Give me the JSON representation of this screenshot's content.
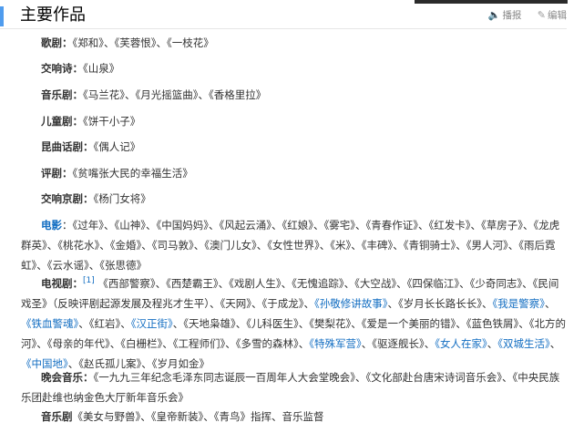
{
  "section": {
    "title": "主要作品",
    "actions": [
      {
        "icon": "speaker-icon",
        "glyph": "🔈",
        "label": "播报"
      },
      {
        "icon": "pencil-icon",
        "glyph": "✎",
        "label": "编辑"
      }
    ]
  },
  "works": [
    {
      "label": "歌剧：",
      "label_link": false,
      "segments": [
        {
          "t": "《郑和》、《芙蓉恨》、《一枝花》"
        }
      ]
    },
    {
      "label": "交响诗：",
      "label_link": false,
      "segments": [
        {
          "t": "《山泉》"
        }
      ]
    },
    {
      "label": "音乐剧：",
      "label_link": false,
      "segments": [
        {
          "t": "《马兰花》、《月光摇篮曲》、《香格里拉》"
        }
      ]
    },
    {
      "label": "儿童剧：",
      "label_link": false,
      "segments": [
        {
          "t": "《饼干小子》"
        }
      ]
    },
    {
      "label": "昆曲话剧：",
      "label_link": false,
      "segments": [
        {
          "t": "《偶人记》"
        }
      ]
    },
    {
      "label": "评剧：",
      "label_link": false,
      "segments": [
        {
          "t": "《贫嘴张大民的幸福生活》"
        }
      ]
    },
    {
      "label": "交响京剧：",
      "label_link": false,
      "segments": [
        {
          "t": "《杨门女将》"
        }
      ]
    },
    {
      "label": "电影",
      "label_link": true,
      "segments": [
        {
          "t": "：《过年》、《山神》、《中国妈妈》、《风起云涌》、《红娘》、《雾宅》、《青春作证》、《红发卡》、《草房子》、《龙虎群英》、《桃花水》、《金婚》、《司马敦》、《澳门儿女》、《女性世界》、《米》、《丰碑》、《青铜骑士》、《男人河》、《雨后霓虹》、《云水谣》、《张思德》"
        }
      ]
    },
    {
      "label": "电视剧：",
      "label_link": false,
      "sup": "[1]",
      "segments": [
        {
          "t": "《西部警察》、《西楚霸王》、《戏剧人生》、《无愧追踪》、《大空战》、《四保临江》、《少奇同志》、《民间戏圣》（反映评剧起源发展及程兆才生平）、《天网》、《于成龙》、"
        },
        {
          "t": "《孙敬修讲故事》",
          "link": true
        },
        {
          "t": "、《岁月长长路长长》、"
        },
        {
          "t": "《我是警察》",
          "link": true
        },
        {
          "t": "、"
        },
        {
          "t": "《铁血警魂》",
          "link": true
        },
        {
          "t": "、《红岩》、"
        },
        {
          "t": "《汉正街》",
          "link": true
        },
        {
          "t": "、《天地枭雄》、《儿科医生》、《樊梨花》、《爱是一个美丽的错》、《蓝色铁屑》、《北方的河》、《母亲的年代》、《白栅栏》、《工程师们》、《多雪的森林》、"
        },
        {
          "t": "《特殊军营》",
          "link": true
        },
        {
          "t": "、《驱逐舰长》、"
        },
        {
          "t": "《女人在家》",
          "link": true
        },
        {
          "t": "、"
        },
        {
          "t": "《双城生活》",
          "link": true
        },
        {
          "t": "、"
        },
        {
          "t": "《中国地》",
          "link": true
        },
        {
          "t": "、《赵氏孤儿案》、《岁月如金》"
        }
      ]
    },
    {
      "label": "晚会音乐：",
      "label_link": false,
      "segments": [
        {
          "t": "《一九九三年纪念毛泽东同志诞辰一百周年人大会堂晚会》、《文化部赴台唐宋诗词音乐会》、《中央民族乐团赴维也纳金色大厅新年音乐会》"
        }
      ]
    },
    {
      "label": "音乐剧",
      "label_link": false,
      "segments": [
        {
          "t": "《美女与野兽》、《皇帝新装》、《青鸟》指挥、音乐监督"
        }
      ]
    }
  ]
}
